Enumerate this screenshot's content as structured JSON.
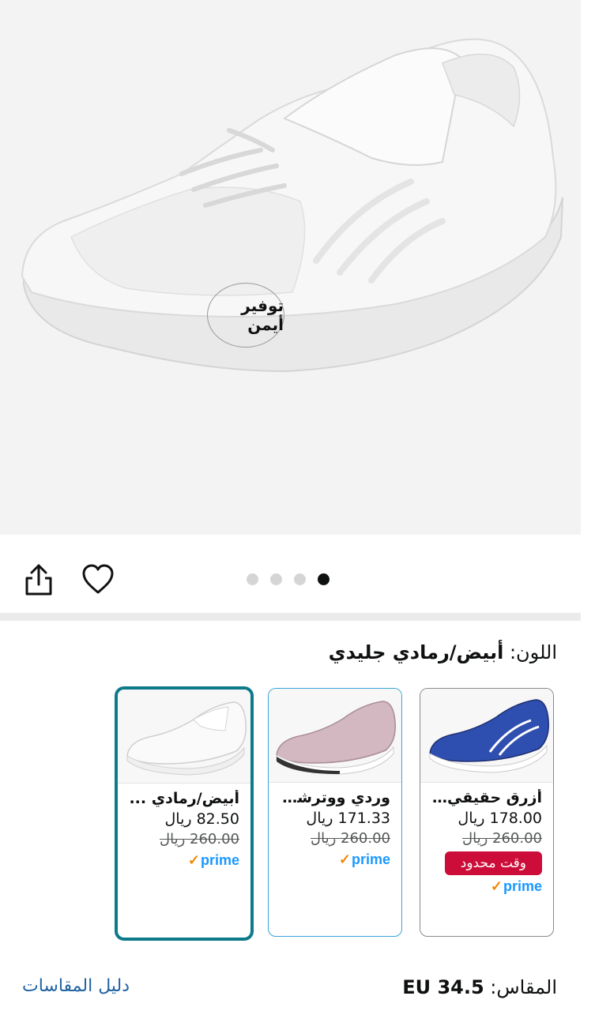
{
  "product_image": {
    "watermark_text": "توفير أيمن",
    "image_count": 4,
    "active_image": 4
  },
  "actions": {
    "share_icon": "share-icon",
    "wishlist_icon": "heart-icon"
  },
  "color": {
    "label": "اللون:",
    "value": "أبيض/رمادي جليدي"
  },
  "variants": [
    {
      "name": "أزرق حقيقي/أ...",
      "price": "178.00 ريال",
      "old_price": "260.00 ريال",
      "badge": "وقت محدود",
      "prime": "prime",
      "shoe_color": "#2f4fb0"
    },
    {
      "name": "وردي ووترشير ...",
      "price": "171.33 ريال",
      "old_price": "260.00 ريال",
      "prime": "prime",
      "shoe_color": "#d3b8c1"
    },
    {
      "name": "أبيض/رمادي ...",
      "price": "82.50 ريال",
      "old_price": "260.00 ريال",
      "prime": "prime",
      "shoe_color": "#f2f2f2",
      "selected": true
    }
  ],
  "size": {
    "label": "المقاس:",
    "value": "EU 34.5",
    "guide_link": "دليل المقاسات"
  },
  "colors": {
    "selected_border": "#0d7a8a",
    "deal_badge": "#cc0c39",
    "prime_blue": "#1a98ff",
    "link": "#2162a1"
  }
}
